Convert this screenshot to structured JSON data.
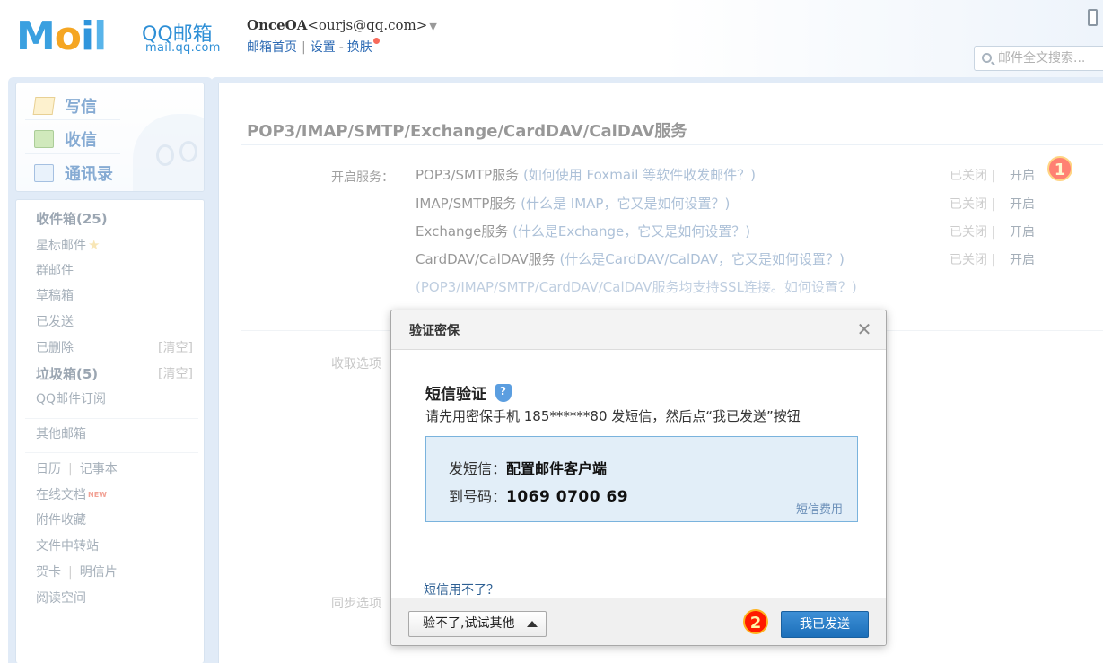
{
  "header": {
    "logo_text": [
      "M",
      "o",
      "i",
      "l"
    ],
    "logo_brand": "QQ邮箱",
    "logo_url": "mail.qq.com",
    "account_name": "OnceOA",
    "account_email": "<ourjs@qq.com>",
    "links": {
      "home": "邮箱首页",
      "settings": "设置",
      "skin": "换肤"
    },
    "search_placeholder": "邮件全文搜索..."
  },
  "sidebar": {
    "quick": {
      "write": "写信",
      "receive": "收信",
      "contacts": "通讯录"
    },
    "folders": {
      "inbox": "收件箱(25)",
      "starred": "星标邮件",
      "group": "群邮件",
      "drafts": "草稿箱",
      "sent": "已发送",
      "deleted": "已删除",
      "spam": "垃圾箱(5)",
      "subscriptions": "QQ邮件订阅",
      "other": "其他邮箱",
      "calendar": "日历",
      "notes": "记事本",
      "docs": "在线文档",
      "docs_badge": "NEW",
      "attachments": "附件收藏",
      "transfer": "文件中转站",
      "cards": "贺卡",
      "postcards": "明信片",
      "reading": "阅读空间",
      "clear_label": "[清空]"
    }
  },
  "main": {
    "title": "POP3/IMAP/SMTP/Exchange/CardDAV/CalDAV服务",
    "services_label": "开启服务：",
    "fetch_label": "收取选项",
    "sync_label": "同步选项",
    "services": [
      {
        "name": "POP3/SMTP服务 ",
        "help": "(如何使用 Foxmail 等软件收发邮件？)",
        "status": "已关闭 |",
        "action": "开启"
      },
      {
        "name": "IMAP/SMTP服务 ",
        "help": "(什么是 IMAP，它又是如何设置？)",
        "status": "已关闭 |",
        "action": "开启"
      },
      {
        "name": "Exchange服务 ",
        "help": "(什么是Exchange，它又是如何设置？)",
        "status": "已关闭 |",
        "action": "开启"
      },
      {
        "name": "CardDAV/CalDAV服务 ",
        "help": "(什么是CardDAV/CalDAV，它又是如何设置？)",
        "status": "已关闭 |",
        "action": "开启"
      }
    ],
    "ssl_note": "(POP3/IMAP/SMTP/CardDAV/CalDAV服务均支持SSL连接。如何设置？)"
  },
  "badges": {
    "step1": "1",
    "step2": "2"
  },
  "dialog": {
    "title": "验证密保",
    "heading": "短信验证",
    "instruction": "请先用密保手机 185******80 发短信，然后点“我已发送”按钮",
    "sms_content_label": "发短信：",
    "sms_content_value": "配置邮件客户端",
    "sms_number_label": "到号码：",
    "sms_number_value": "1069 0700 69",
    "sms_fee": "短信费用",
    "cannot_use_sms": "短信用不了？",
    "try_other_button": "验不了,试试其他",
    "sent_button": "我已发送"
  },
  "colors": {
    "accent": "#1c6fba",
    "link": "#2e6bb4",
    "badge_red": "#ff1a00"
  }
}
